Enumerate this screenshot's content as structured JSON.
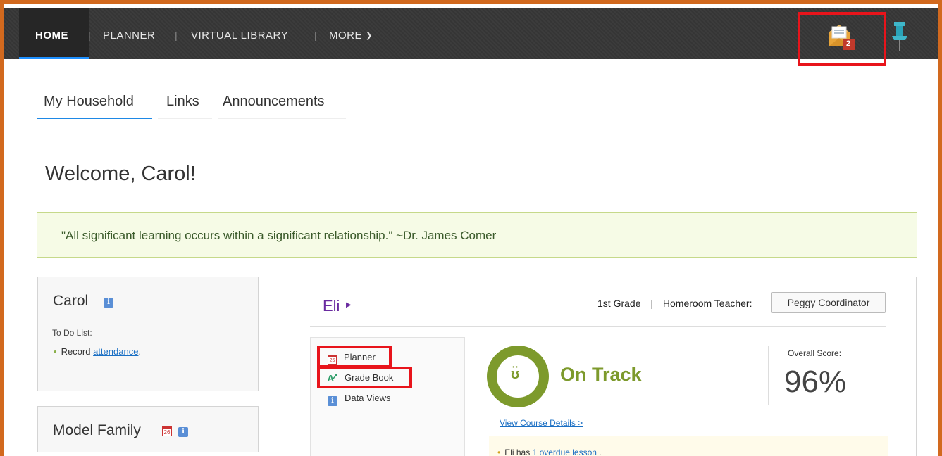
{
  "nav": {
    "items": [
      {
        "label": "HOME",
        "active": true
      },
      {
        "label": "PLANNER",
        "active": false
      },
      {
        "label": "VIRTUAL LIBRARY",
        "active": false
      },
      {
        "label": "MORE",
        "active": false
      }
    ],
    "mail_count": "2"
  },
  "tabs": [
    {
      "label": "My Household",
      "active": true
    },
    {
      "label": "Links",
      "active": false
    },
    {
      "label": "Announcements",
      "active": false
    }
  ],
  "welcome": "Welcome, Carol!",
  "quote": "\"All significant learning occurs within a significant relationship.\" ~Dr. James Comer",
  "cards": {
    "carol": {
      "title": "Carol",
      "todo_label": "To Do List:",
      "todo_prefix": "Record ",
      "todo_link": "attendance",
      "todo_suffix": "."
    },
    "family": {
      "title": "Model Family"
    }
  },
  "student": {
    "name": "Eli",
    "grade": "1st Grade",
    "homeroom_label": "Homeroom Teacher:",
    "teacher": "Peggy Coordinator",
    "menu": [
      {
        "label": "Planner",
        "icon": "calendar-icon"
      },
      {
        "label": "Grade Book",
        "icon": "gradebook-icon"
      },
      {
        "label": "Data Views",
        "icon": "info-icon"
      }
    ],
    "status": "On Track",
    "score_label": "Overall Score:",
    "score_value": "96%",
    "course_link": "View Course Details >",
    "notice_prefix": "Eli has ",
    "notice_link": "1 overdue lesson ",
    "notice_suffix": "."
  },
  "colors": {
    "frame": "#d2691e",
    "highlight": "#e8141b",
    "on_track": "#7d9a2c",
    "student_name": "#6a2ba0",
    "link": "#1a6fc4"
  }
}
